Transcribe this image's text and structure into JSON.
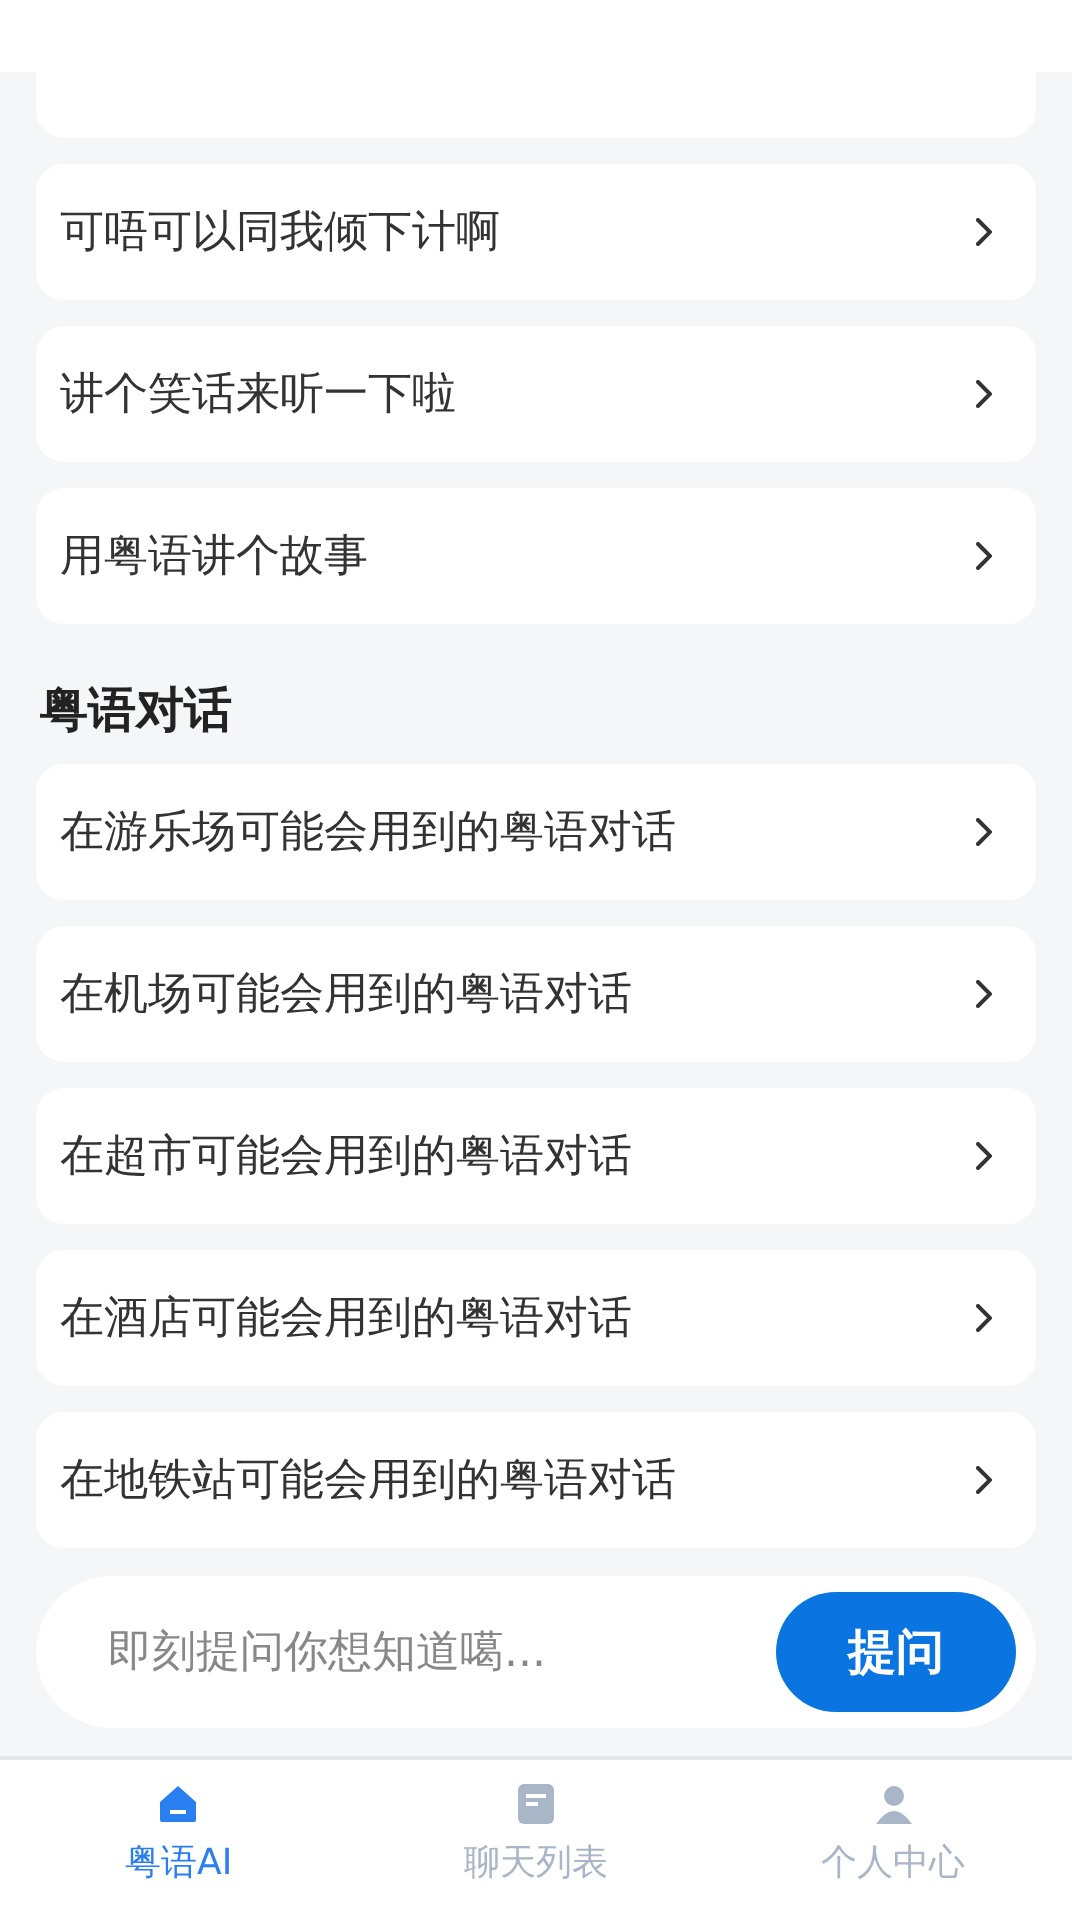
{
  "suggestions": [
    {
      "text": "可唔可以同我倾下计啊"
    },
    {
      "text": "讲个笑话来听一下啦"
    },
    {
      "text": "用粤语讲个故事"
    }
  ],
  "section": {
    "title": "粤语对话",
    "items": [
      {
        "text": "在游乐场可能会用到的粤语对话"
      },
      {
        "text": "在机场可能会用到的粤语对话"
      },
      {
        "text": "在超市可能会用到的粤语对话"
      },
      {
        "text": "在酒店可能会用到的粤语对话"
      },
      {
        "text": "在地铁站可能会用到的粤语对话"
      }
    ]
  },
  "ask": {
    "placeholder": "即刻提问你想知道噶...",
    "button": "提问"
  },
  "tabs": [
    {
      "kind": "home",
      "label": "粤语AI",
      "selected": true
    },
    {
      "kind": "list",
      "label": "聊天列表",
      "selected": false
    },
    {
      "kind": "user",
      "label": "个人中心",
      "selected": false
    }
  ]
}
